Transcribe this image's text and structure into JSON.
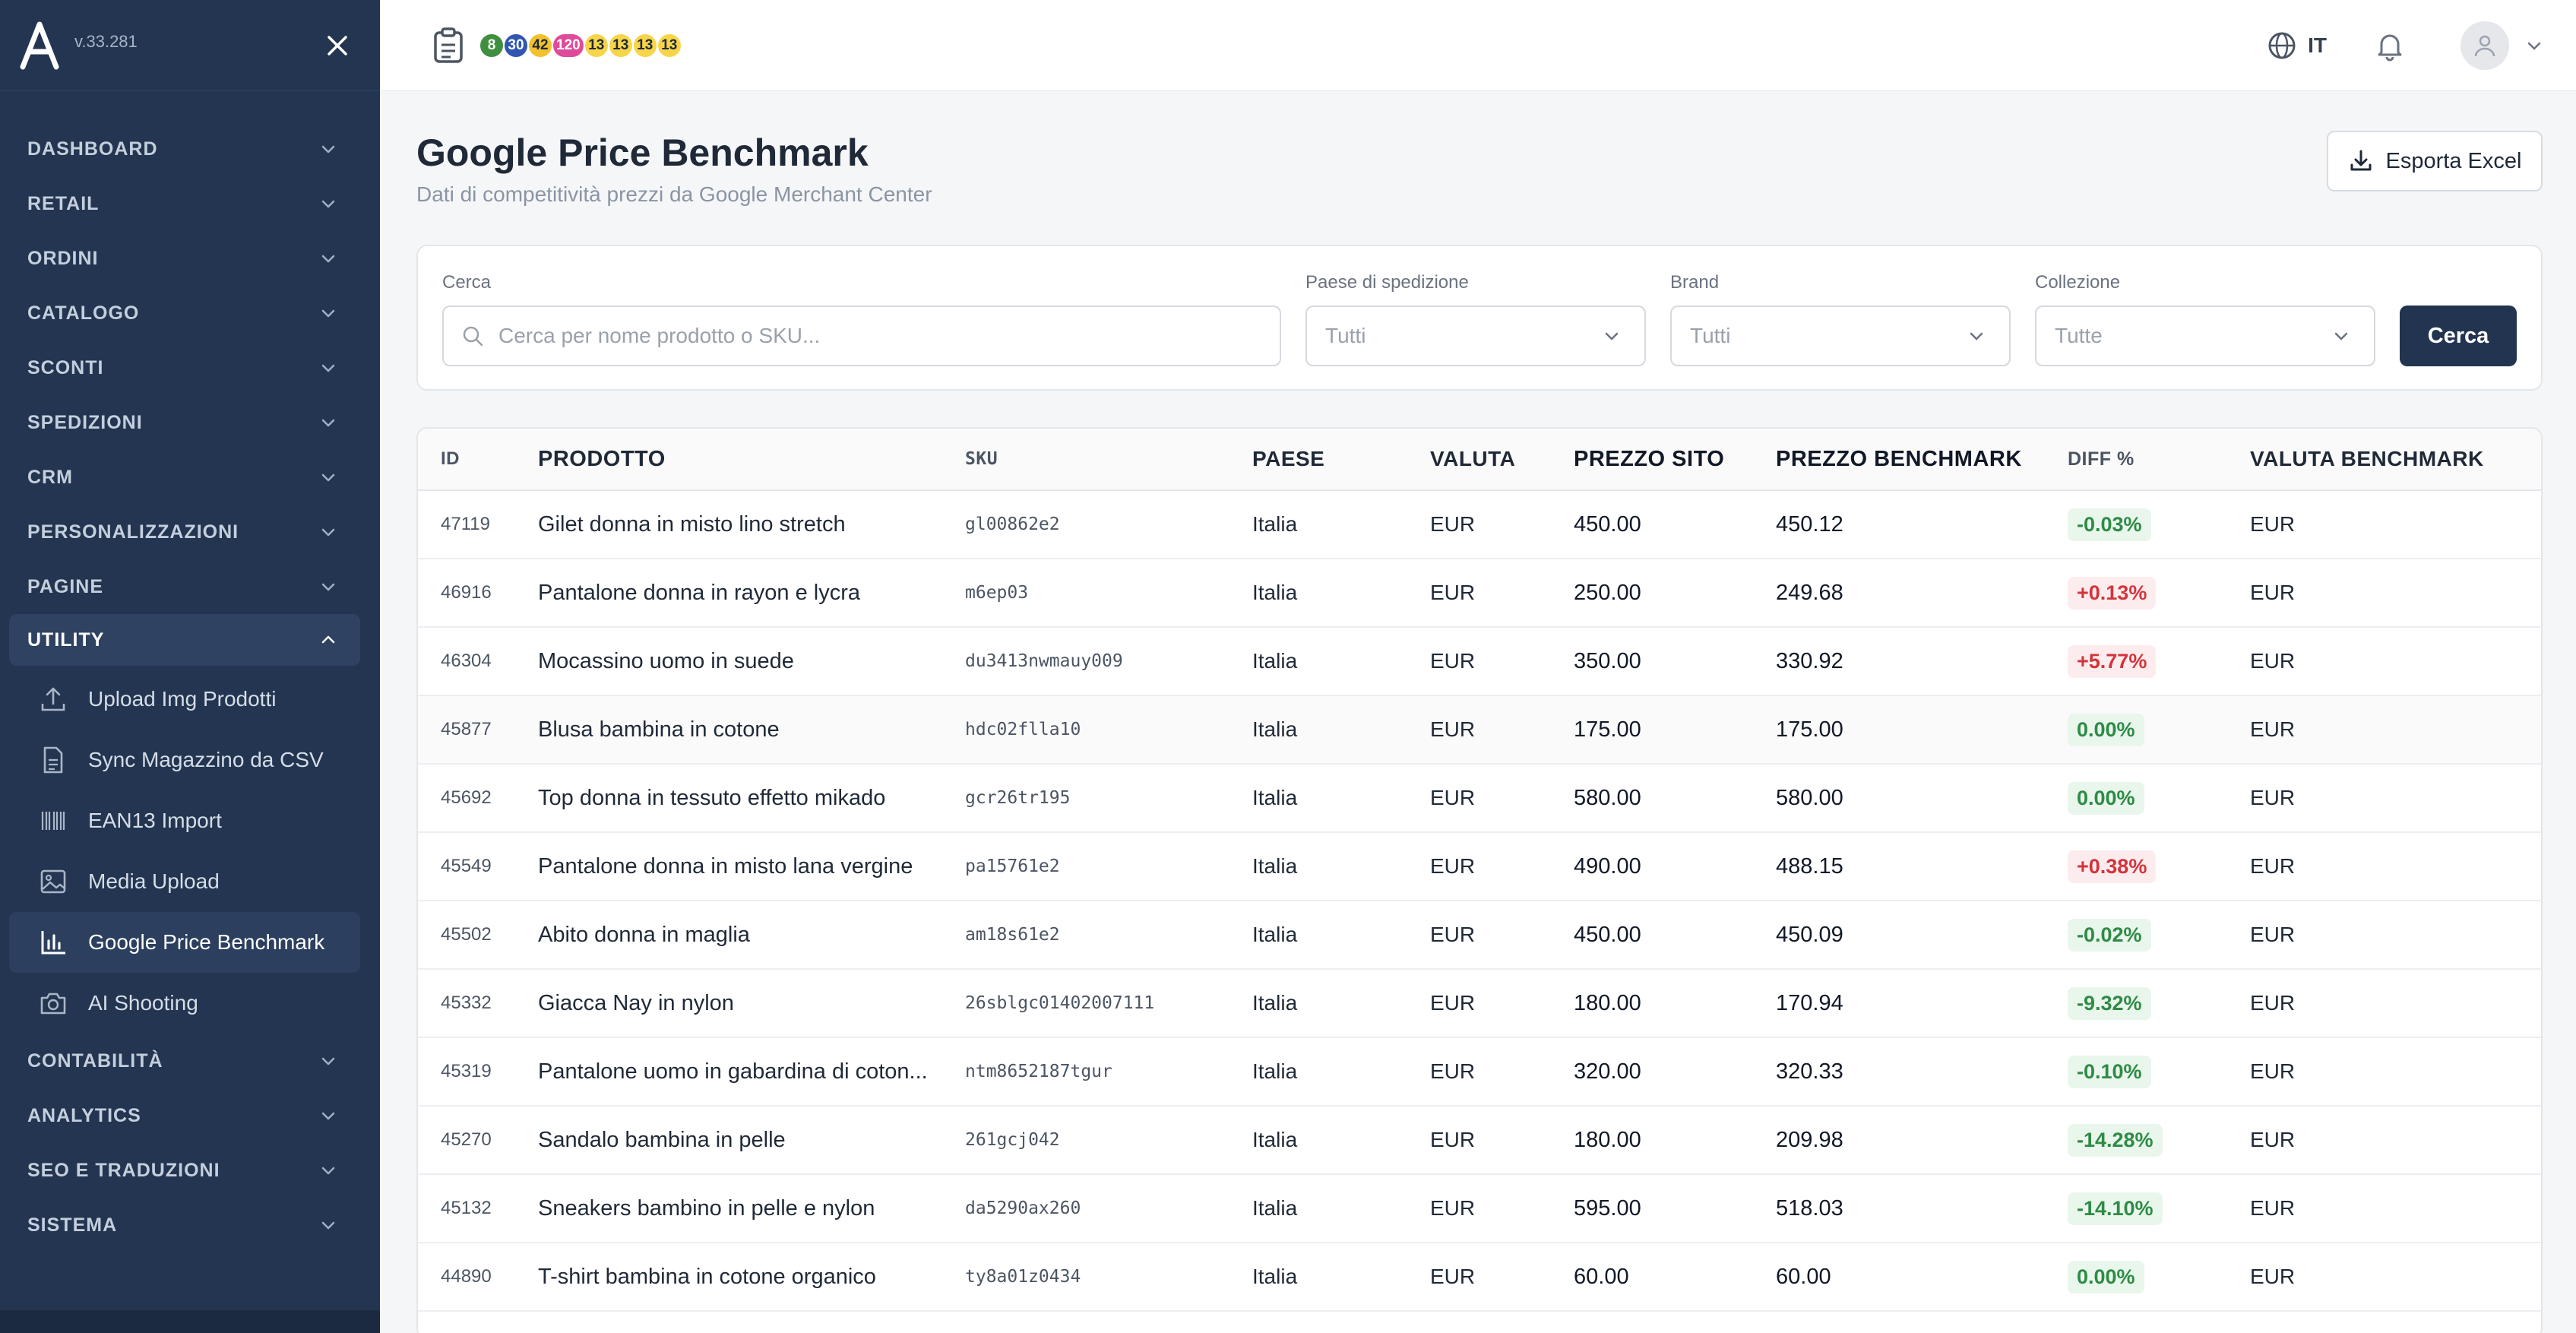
{
  "app": {
    "version": "v.33.281",
    "language": "IT"
  },
  "colors": {
    "sidebar_bg": "#233550",
    "primary": "#223450",
    "positive_diff": "#2e8b45",
    "negative_diff": "#d3343c"
  },
  "badges": [
    {
      "value": "8",
      "bg": "#3f8f3f",
      "fg": "#ffffff"
    },
    {
      "value": "30",
      "bg": "#2f56b0",
      "fg": "#ffffff"
    },
    {
      "value": "42",
      "bg": "#f2c12e",
      "fg": "#1f2937"
    },
    {
      "value": "120",
      "bg": "#e04a9a",
      "fg": "#ffffff"
    },
    {
      "value": "13",
      "bg": "#f7d54a",
      "fg": "#1f2937"
    },
    {
      "value": "13",
      "bg": "#f7d54a",
      "fg": "#1f2937"
    },
    {
      "value": "13",
      "bg": "#f7d54a",
      "fg": "#1f2937"
    },
    {
      "value": "13",
      "bg": "#f7d54a",
      "fg": "#1f2937"
    }
  ],
  "sidebar": {
    "sections_top": [
      "DASHBOARD",
      "RETAIL",
      "ORDINI",
      "CATALOGO",
      "SCONTI",
      "SPEDIZIONI",
      "CRM",
      "PERSONALIZZAZIONI",
      "PAGINE"
    ],
    "open_section": "UTILITY",
    "sub_items": [
      {
        "label": "Upload Img Prodotti",
        "icon": "upload-icon"
      },
      {
        "label": "Sync Magazzino da CSV",
        "icon": "file-csv-icon"
      },
      {
        "label": "EAN13 Import",
        "icon": "barcode-icon"
      },
      {
        "label": "Media Upload",
        "icon": "image-icon"
      },
      {
        "label": "Google Price Benchmark",
        "icon": "bar-chart-icon",
        "active": true
      },
      {
        "label": "AI Shooting",
        "icon": "camera-icon"
      }
    ],
    "sections_bottom": [
      "CONTABILITÀ",
      "ANALYTICS",
      "SEO E TRADUZIONI",
      "SISTEMA"
    ]
  },
  "page": {
    "title": "Google Price Benchmark",
    "subtitle": "Dati di competitività prezzi da Google Merchant Center",
    "export_label": "Esporta Excel"
  },
  "filters": {
    "search_label": "Cerca",
    "search_placeholder": "Cerca per nome prodotto o SKU...",
    "country_label": "Paese di spedizione",
    "country_value": "Tutti",
    "brand_label": "Brand",
    "brand_value": "Tutti",
    "collection_label": "Collezione",
    "collection_value": "Tutte",
    "search_button": "Cerca"
  },
  "table": {
    "headers": [
      "ID",
      "PRODOTTO",
      "SKU",
      "PAESE",
      "VALUTA",
      "PREZZO SITO",
      "PREZZO BENCHMARK",
      "DIFF %",
      "VALUTA BENCHMARK"
    ],
    "rows": [
      {
        "id": "47119",
        "product": "Gilet donna in misto lino stretch",
        "sku": "gl00862e2",
        "country": "Italia",
        "currency": "EUR",
        "site_price": "450.00",
        "bench_price": "450.12",
        "diff": "-0.03%",
        "diff_type": "neg",
        "bench_currency": "EUR"
      },
      {
        "id": "46916",
        "product": "Pantalone donna in rayon e lycra",
        "sku": "m6ep03",
        "country": "Italia",
        "currency": "EUR",
        "site_price": "250.00",
        "bench_price": "249.68",
        "diff": "+0.13%",
        "diff_type": "pos",
        "bench_currency": "EUR"
      },
      {
        "id": "46304",
        "product": "Mocassino uomo in suede",
        "sku": "du3413nwmauy009",
        "country": "Italia",
        "currency": "EUR",
        "site_price": "350.00",
        "bench_price": "330.92",
        "diff": "+5.77%",
        "diff_type": "pos",
        "bench_currency": "EUR"
      },
      {
        "id": "45877",
        "product": "Blusa bambina in cotone",
        "sku": "hdc02flla10",
        "country": "Italia",
        "currency": "EUR",
        "site_price": "175.00",
        "bench_price": "175.00",
        "diff": "0.00%",
        "diff_type": "neg",
        "bench_currency": "EUR"
      },
      {
        "id": "45692",
        "product": "Top donna in tessuto effetto mikado",
        "sku": "gcr26tr195",
        "country": "Italia",
        "currency": "EUR",
        "site_price": "580.00",
        "bench_price": "580.00",
        "diff": "0.00%",
        "diff_type": "neg",
        "bench_currency": "EUR"
      },
      {
        "id": "45549",
        "product": "Pantalone donna in misto lana vergine",
        "sku": "pa15761e2",
        "country": "Italia",
        "currency": "EUR",
        "site_price": "490.00",
        "bench_price": "488.15",
        "diff": "+0.38%",
        "diff_type": "pos",
        "bench_currency": "EUR"
      },
      {
        "id": "45502",
        "product": "Abito donna in maglia",
        "sku": "am18s61e2",
        "country": "Italia",
        "currency": "EUR",
        "site_price": "450.00",
        "bench_price": "450.09",
        "diff": "-0.02%",
        "diff_type": "neg",
        "bench_currency": "EUR"
      },
      {
        "id": "45332",
        "product": "Giacca Nay in nylon",
        "sku": "26sblgc01402007111",
        "country": "Italia",
        "currency": "EUR",
        "site_price": "180.00",
        "bench_price": "170.94",
        "diff": "-9.32%",
        "diff_type": "neg",
        "bench_currency": "EUR"
      },
      {
        "id": "45319",
        "product": "Pantalone uomo in gabardina di coton...",
        "sku": "ntm8652187tgur",
        "country": "Italia",
        "currency": "EUR",
        "site_price": "320.00",
        "bench_price": "320.33",
        "diff": "-0.10%",
        "diff_type": "neg",
        "bench_currency": "EUR"
      },
      {
        "id": "45270",
        "product": "Sandalo bambina in pelle",
        "sku": "261gcj042",
        "country": "Italia",
        "currency": "EUR",
        "site_price": "180.00",
        "bench_price": "209.98",
        "diff": "-14.28%",
        "diff_type": "neg",
        "bench_currency": "EUR"
      },
      {
        "id": "45132",
        "product": "Sneakers bambino in pelle e nylon",
        "sku": "da5290ax260",
        "country": "Italia",
        "currency": "EUR",
        "site_price": "595.00",
        "bench_price": "518.03",
        "diff": "-14.10%",
        "diff_type": "neg",
        "bench_currency": "EUR"
      },
      {
        "id": "44890",
        "product": "T-shirt bambina in cotone organico",
        "sku": "ty8a01z0434",
        "country": "Italia",
        "currency": "EUR",
        "site_price": "60.00",
        "bench_price": "60.00",
        "diff": "0.00%",
        "diff_type": "neg",
        "bench_currency": "EUR"
      }
    ]
  }
}
